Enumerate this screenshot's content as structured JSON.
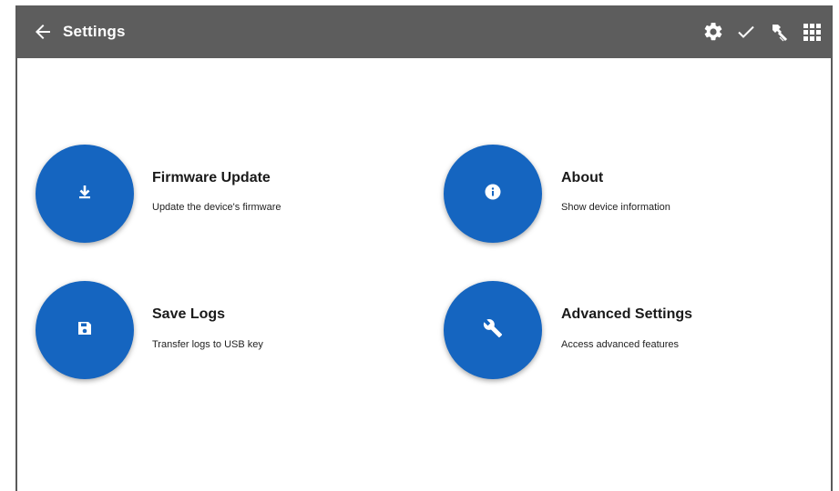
{
  "header": {
    "back_icon": "arrow-left-icon",
    "title": "Settings",
    "actions": [
      {
        "icon": "gear-icon"
      },
      {
        "icon": "checkmark-icon"
      },
      {
        "icon": "hammer-icon"
      },
      {
        "icon": "grid-icon"
      }
    ]
  },
  "colors": {
    "topbar": "#5d5d5d",
    "accent": "#1565c0"
  },
  "items": [
    {
      "title": "Firmware Update",
      "subtitle": "Update the device's firmware",
      "icon": "download-icon"
    },
    {
      "title": "About",
      "subtitle": "Show device information",
      "icon": "info-icon"
    },
    {
      "title": "Save Logs",
      "subtitle": "Transfer logs to USB key",
      "icon": "save-icon"
    },
    {
      "title": "Advanced Settings",
      "subtitle": "Access advanced features",
      "icon": "wrench-icon"
    }
  ]
}
